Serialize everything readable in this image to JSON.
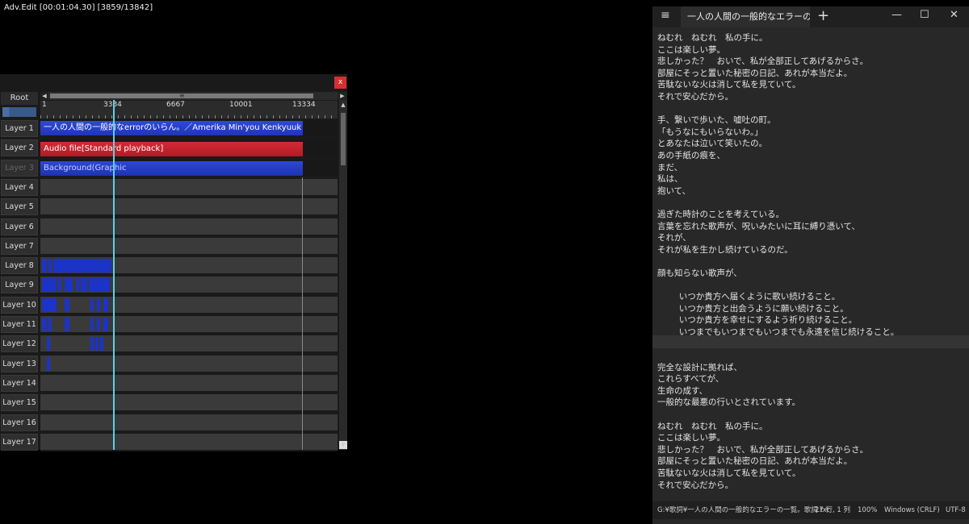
{
  "timeline": {
    "title": "Adv.Edit [00:01:04.30] [3859/13842]",
    "close_label": "x",
    "root_label": "Root",
    "scroll_left": "◀",
    "scroll_right": "▶",
    "scroll_up": "▲",
    "scroll_down": "▼",
    "scroll_grip": "≡",
    "ticks": [
      "1",
      "3334",
      "6667",
      "10001",
      "13334"
    ],
    "layers": [
      "Layer 1",
      "Layer 2",
      "Layer 3",
      "Layer 4",
      "Layer 5",
      "Layer 6",
      "Layer 7",
      "Layer 8",
      "Layer 9",
      "Layer 10",
      "Layer 11",
      "Layer 12",
      "Layer 13",
      "Layer 14",
      "Layer 15",
      "Layer 16",
      "Layer 17"
    ],
    "clips": {
      "text": "一人の人間の一般的なerrorのいらん。／Amerika Min'you Kenkyuuk",
      "audio": "Audio file[Standard playback]",
      "background": "Background(Graphic"
    },
    "colors": {
      "text_clip": "#2f49d8",
      "audio_clip": "#d42a34",
      "playhead": "#5fd0e0"
    }
  },
  "notepad": {
    "tab_title": "一人の人間の一般的なエラーの-",
    "new_tab": "+",
    "menu_icon": "≡",
    "minimize": "—",
    "maximize": "☐",
    "close": "✕",
    "text": "ねむれ　ねむれ　私の手に。\nここは楽しい夢。\n悲しかった？　おいで、私が全部正してあげるからさ。\n部屋にそっと置いた秘密の日記、あれが本当だよ。\n苦駄ないな火は消して私を見ていて。\nそれで安心だから。\n\n手、繋いで歩いた、嘘吐の町。\n「もうなにもいらないわ。」\nとあなたは泣いて笑いたの。\nあの手紙の痕を、\nまだ、\n私は、\n抱いて、\n\n過ぎた時計のことを考えている。\n言葉を忘れた歌声が、呪いみたいに耳に縛り憑いて、\nそれが、\nそれが私を生かし続けているのだ。\n\n顔も知らない歌声が、\n\n        いつか貴方へ届くように歌い続けること。\n        いつか貴方と出会うように願い続けること。\n        いつか貴方を幸せにするよう祈り続けること。\n        いつまでもいつまでもいつまでも永遠を信じ続けること。\n\n\n完全な設計に拠れば、\nこれらすべてが、\n生命の成す、\n一般的な最悪の行いとされています。\n\nねむれ　ねむれ　私の手に。\nここは楽しい夢。\n悲しかった？　おいで、私が全部正してあげるからさ。\n部屋にそっと置いた秘密の日記、あれが本当だよ。\n苦駄ないな火は消して私を見ていて。\nそれで安心だから。",
    "status": {
      "path": "G:¥歌詞¥一人の人間の一般的なエラーの一覧。歌詞.txt",
      "position": "27 行, 1 列",
      "zoom": "100%",
      "line_ending": "Windows (CRLF)",
      "encoding": "UTF-8"
    }
  }
}
